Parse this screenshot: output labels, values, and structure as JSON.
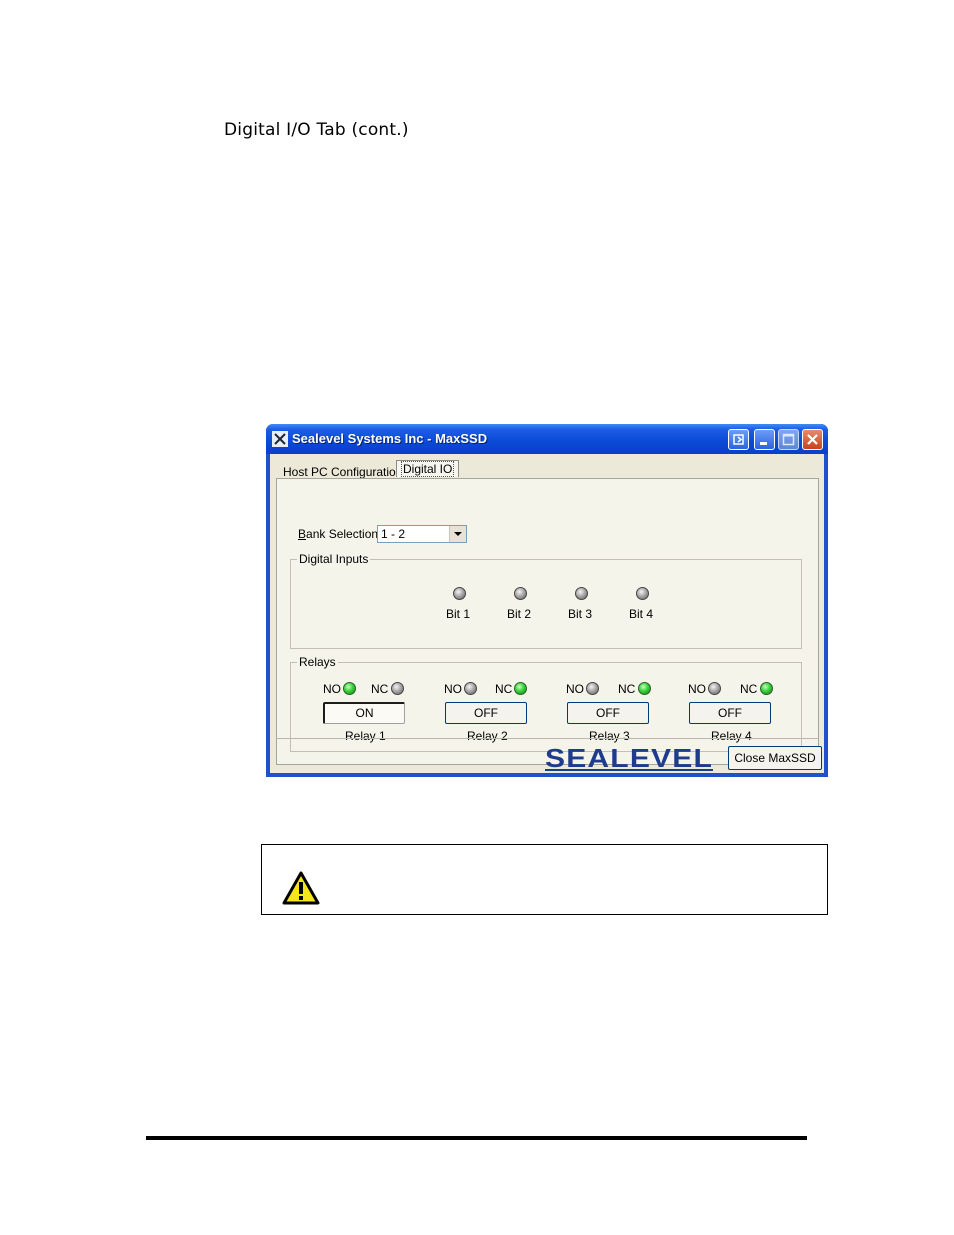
{
  "heading": "Digital I/O Tab (cont.)",
  "window": {
    "title": "Sealevel Systems Inc - MaxSSD",
    "tabs": [
      {
        "label": "Host PC Configuration"
      },
      {
        "label": "Digital IO"
      }
    ],
    "bank_selection": {
      "label": "Bank Selection",
      "value": "1 - 2"
    },
    "digital_inputs": {
      "title": "Digital Inputs",
      "bits": [
        {
          "label": "Bit 1",
          "state": "off"
        },
        {
          "label": "Bit 2",
          "state": "off"
        },
        {
          "label": "Bit 3",
          "state": "off"
        },
        {
          "label": "Bit 4",
          "state": "off"
        }
      ]
    },
    "relays": {
      "title": "Relays",
      "no_label": "NO",
      "nc_label": "NC",
      "items": [
        {
          "name": "Relay 1",
          "button": "ON",
          "no": "green",
          "nc": "gray",
          "pressed": true
        },
        {
          "name": "Relay 2",
          "button": "OFF",
          "no": "gray",
          "nc": "green",
          "pressed": false
        },
        {
          "name": "Relay 3",
          "button": "OFF",
          "no": "gray",
          "nc": "green",
          "pressed": false
        },
        {
          "name": "Relay 4",
          "button": "OFF",
          "no": "gray",
          "nc": "green",
          "pressed": false
        }
      ]
    },
    "logo": "SEALEVEL",
    "close_button": "Close MaxSSD"
  },
  "colors": {
    "titlebar": "#0a49d6",
    "led_green": "#39d23a",
    "led_gray": "#a9a9a9",
    "logo": "#1f3c8c"
  }
}
